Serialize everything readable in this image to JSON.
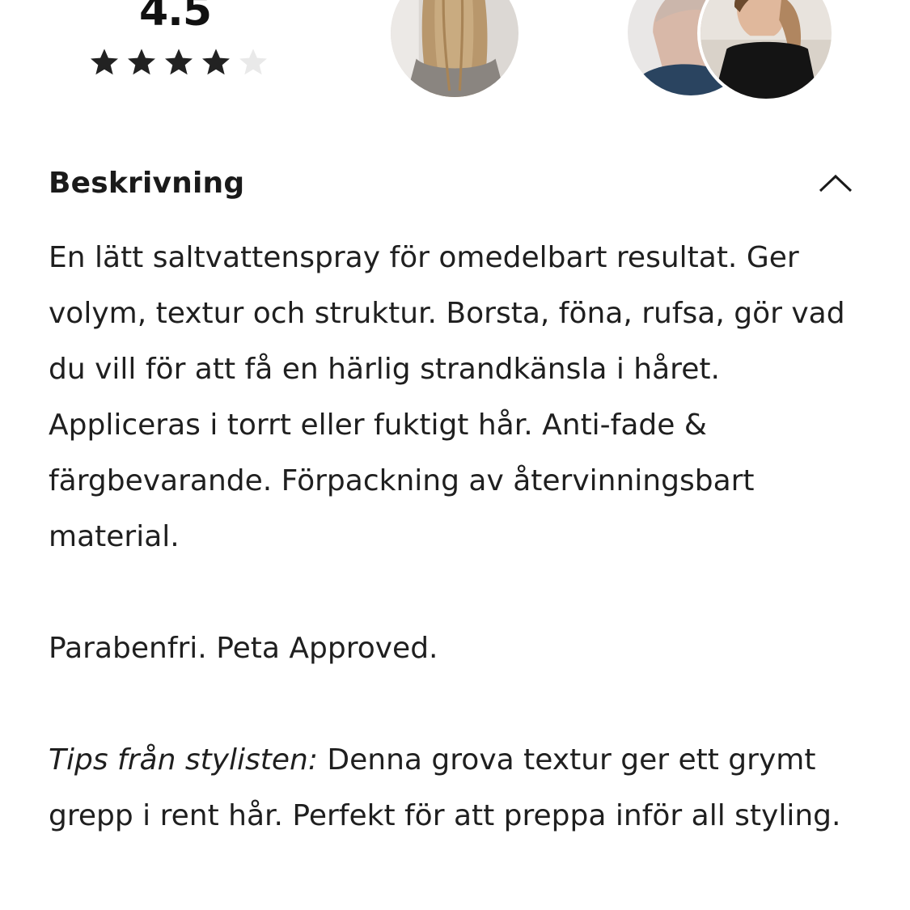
{
  "rating": {
    "value": "4.5",
    "stars": [
      {
        "state": "filled"
      },
      {
        "state": "filled"
      },
      {
        "state": "filled"
      },
      {
        "state": "filled"
      },
      {
        "state": "empty"
      }
    ],
    "filled_color": "#222222",
    "empty_color": "#e6e6e6"
  },
  "gallery": {
    "avatars": [
      {
        "name": "long-blonde-hair"
      },
      {
        "name": "short-haircut"
      },
      {
        "name": "ponytail-with-bow"
      }
    ]
  },
  "description_section": {
    "title": "Beskrivning",
    "expanded": true,
    "toggle_icon": "chevron-up-icon",
    "paragraph_1": "En lätt saltvattenspray för omedelbart resultat. Ger volym, textur och struktur. Borsta, föna, rufsa, gör vad du vill för att få en härlig strandkänsla i håret. Appliceras i torrt eller fuktigt hår. Anti-fade & färgbevarande. Förpackning av återvinningsbart material.",
    "paragraph_2": "Parabenfri. Peta Approved.",
    "tip_label": "Tips från stylisten:",
    "tip_text": " Denna grova textur ger ett grymt grepp i rent hår. Perfekt för att preppa inför all styling."
  }
}
